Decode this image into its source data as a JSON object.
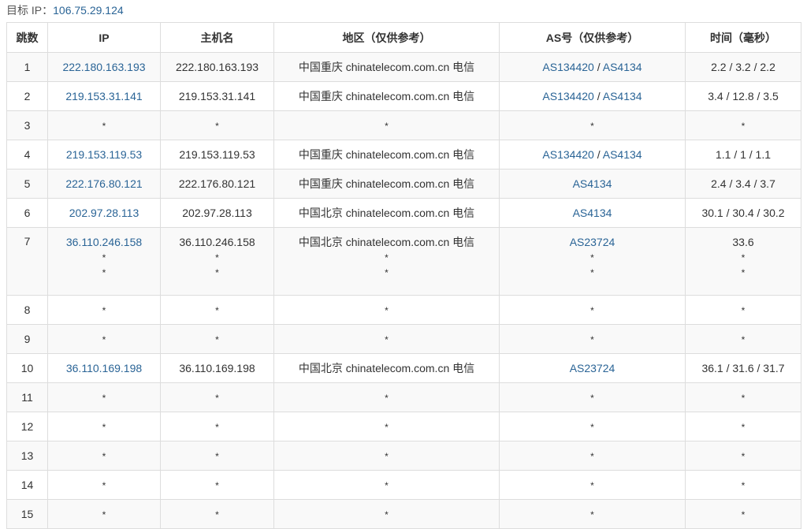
{
  "target": {
    "label": "目标 IP：",
    "ip": "106.75.29.124"
  },
  "columns": [
    "跳数",
    "IP",
    "主机名",
    "地区（仅供参考）",
    "AS号（仅供参考）",
    "时间（毫秒）"
  ],
  "colors": {
    "link": "#2a6496",
    "border": "#dddddd",
    "stripe": "#f9f9f9"
  },
  "rows": [
    {
      "hop": "1",
      "lines": [
        {
          "ip": "222.180.163.193",
          "host": "222.180.163.193",
          "region": "中国重庆 chinatelecom.com.cn 电信",
          "as": [
            "AS134420",
            "AS4134"
          ],
          "time": "2.2 / 3.2 / 2.2"
        }
      ]
    },
    {
      "hop": "2",
      "lines": [
        {
          "ip": "219.153.31.141",
          "host": "219.153.31.141",
          "region": "中国重庆 chinatelecom.com.cn 电信",
          "as": [
            "AS134420",
            "AS4134"
          ],
          "time": "3.4 / 12.8 / 3.5"
        }
      ]
    },
    {
      "hop": "3",
      "lines": [
        {
          "ip": "*",
          "host": "*",
          "region": "*",
          "as": [],
          "time": "*"
        }
      ]
    },
    {
      "hop": "4",
      "lines": [
        {
          "ip": "219.153.119.53",
          "host": "219.153.119.53",
          "region": "中国重庆 chinatelecom.com.cn 电信",
          "as": [
            "AS134420",
            "AS4134"
          ],
          "time": "1.1 / 1 / 1.1"
        }
      ]
    },
    {
      "hop": "5",
      "lines": [
        {
          "ip": "222.176.80.121",
          "host": "222.176.80.121",
          "region": "中国重庆 chinatelecom.com.cn 电信",
          "as": [
            "AS4134"
          ],
          "time": "2.4 / 3.4 / 3.7"
        }
      ]
    },
    {
      "hop": "6",
      "lines": [
        {
          "ip": "202.97.28.113",
          "host": "202.97.28.113",
          "region": "中国北京 chinatelecom.com.cn 电信",
          "as": [
            "AS4134"
          ],
          "time": "30.1 / 30.4 / 30.2"
        }
      ]
    },
    {
      "hop": "7",
      "lines": [
        {
          "ip": "36.110.246.158",
          "host": "36.110.246.158",
          "region": "中国北京 chinatelecom.com.cn 电信",
          "as": [
            "AS23724"
          ],
          "time": "33.6"
        },
        {
          "ip": "*",
          "host": "*",
          "region": "*",
          "as": [],
          "time": "*"
        },
        {
          "ip": "*",
          "host": "*",
          "region": "*",
          "as": [],
          "time": "*"
        }
      ]
    },
    {
      "hop": "8",
      "lines": [
        {
          "ip": "*",
          "host": "*",
          "region": "*",
          "as": [],
          "time": "*"
        }
      ]
    },
    {
      "hop": "9",
      "lines": [
        {
          "ip": "*",
          "host": "*",
          "region": "*",
          "as": [],
          "time": "*"
        }
      ]
    },
    {
      "hop": "10",
      "lines": [
        {
          "ip": "36.110.169.198",
          "host": "36.110.169.198",
          "region": "中国北京 chinatelecom.com.cn 电信",
          "as": [
            "AS23724"
          ],
          "time": "36.1 / 31.6 / 31.7"
        }
      ]
    },
    {
      "hop": "11",
      "lines": [
        {
          "ip": "*",
          "host": "*",
          "region": "*",
          "as": [],
          "time": "*"
        }
      ]
    },
    {
      "hop": "12",
      "lines": [
        {
          "ip": "*",
          "host": "*",
          "region": "*",
          "as": [],
          "time": "*"
        }
      ]
    },
    {
      "hop": "13",
      "lines": [
        {
          "ip": "*",
          "host": "*",
          "region": "*",
          "as": [],
          "time": "*"
        }
      ]
    },
    {
      "hop": "14",
      "lines": [
        {
          "ip": "*",
          "host": "*",
          "region": "*",
          "as": [],
          "time": "*"
        }
      ]
    },
    {
      "hop": "15",
      "lines": [
        {
          "ip": "*",
          "host": "*",
          "region": "*",
          "as": [],
          "time": "*"
        }
      ]
    }
  ]
}
